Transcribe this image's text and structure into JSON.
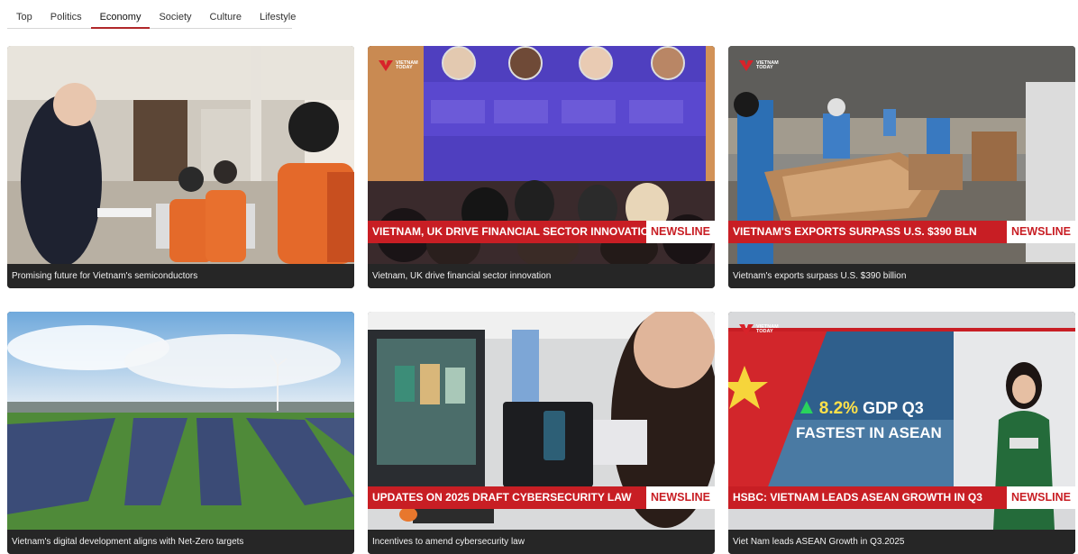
{
  "tabs": [
    {
      "label": "Top",
      "active": false
    },
    {
      "label": "Politics",
      "active": false
    },
    {
      "label": "Economy",
      "active": true
    },
    {
      "label": "Society",
      "active": false
    },
    {
      "label": "Culture",
      "active": false
    },
    {
      "label": "Lifestyle",
      "active": false
    }
  ],
  "brand": {
    "accent": "#b1282a",
    "banner_red": "#c81e24",
    "logo_text": "VIETNAM\nTODAY"
  },
  "cards": [
    {
      "caption": "Promising future for Vietnam's semiconductors"
    },
    {
      "caption": "Vietnam, UK drive financial sector innovation",
      "banner": "VIETNAM, UK DRIVE FINANCIAL SECTOR INNOVATION",
      "badge": "NEWSLINE"
    },
    {
      "caption": "Vietnam's exports surpass U.S. $390 billion",
      "banner": "VIETNAM'S EXPORTS SURPASS U.S. $390 BLN",
      "badge": "NEWSLINE"
    },
    {
      "caption": "Vietnam's digital development aligns with Net-Zero targets"
    },
    {
      "caption": "Incentives to amend cybersecurity law",
      "banner": "UPDATES ON 2025 DRAFT CYBERSECURITY LAW",
      "badge": "NEWSLINE"
    },
    {
      "caption": "Viet Nam leads ASEAN Growth in Q3.2025",
      "banner": "HSBC: VIETNAM LEADS ASEAN GROWTH IN Q3",
      "badge": "NEWSLINE",
      "screen": {
        "pct": "8.2%",
        "line1_rest": " GDP Q3",
        "line2": "FASTEST IN ASEAN"
      }
    }
  ]
}
